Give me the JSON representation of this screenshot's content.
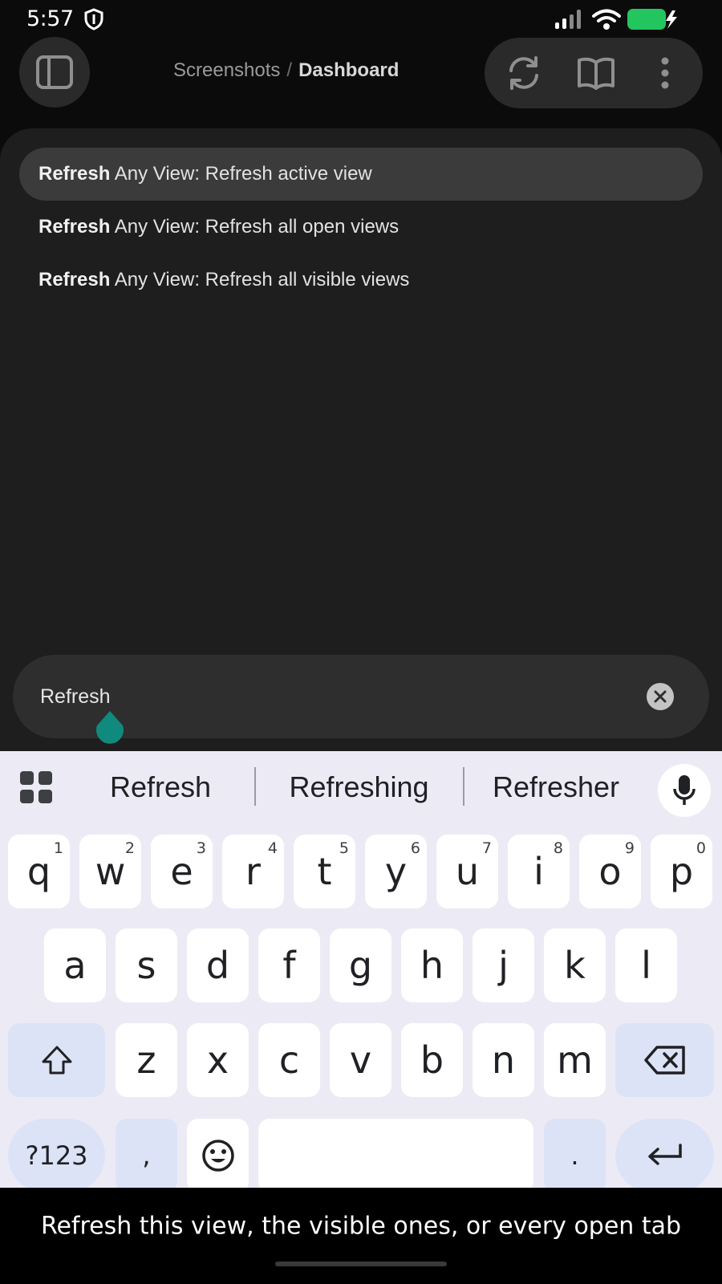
{
  "status_bar": {
    "time": "5:57",
    "battery_color": "#22c55e"
  },
  "header": {
    "breadcrumb": {
      "parent": "Screenshots",
      "separator": "/",
      "current": "Dashboard"
    },
    "icons": [
      "sidebar-toggle-icon",
      "refresh-icon",
      "book-icon",
      "more-vertical-icon"
    ]
  },
  "command_suggestions": [
    {
      "match": "Refresh",
      "rest": " Any View: Refresh active view",
      "selected": true
    },
    {
      "match": "Refresh",
      "rest": " Any View: Refresh all open views",
      "selected": false
    },
    {
      "match": "Refresh",
      "rest": " Any View: Refresh all visible views",
      "selected": false
    }
  ],
  "prompt": {
    "value": "Refresh",
    "handle_color": "#0f8a7c"
  },
  "keyboard": {
    "word_suggestions": [
      "Refresh",
      "Refreshing",
      "Refresher"
    ],
    "row1": [
      {
        "key": "q",
        "hint": "1"
      },
      {
        "key": "w",
        "hint": "2"
      },
      {
        "key": "e",
        "hint": "3"
      },
      {
        "key": "r",
        "hint": "4"
      },
      {
        "key": "t",
        "hint": "5"
      },
      {
        "key": "y",
        "hint": "6"
      },
      {
        "key": "u",
        "hint": "7"
      },
      {
        "key": "i",
        "hint": "8"
      },
      {
        "key": "o",
        "hint": "9"
      },
      {
        "key": "p",
        "hint": "0"
      }
    ],
    "row2": [
      "a",
      "s",
      "d",
      "f",
      "g",
      "h",
      "j",
      "k",
      "l"
    ],
    "row3": [
      "z",
      "x",
      "c",
      "v",
      "b",
      "n",
      "m"
    ],
    "symbols_label": "?123",
    "comma": ",",
    "period": "."
  },
  "caption": "Refresh this view, the visible ones, or every open tab"
}
